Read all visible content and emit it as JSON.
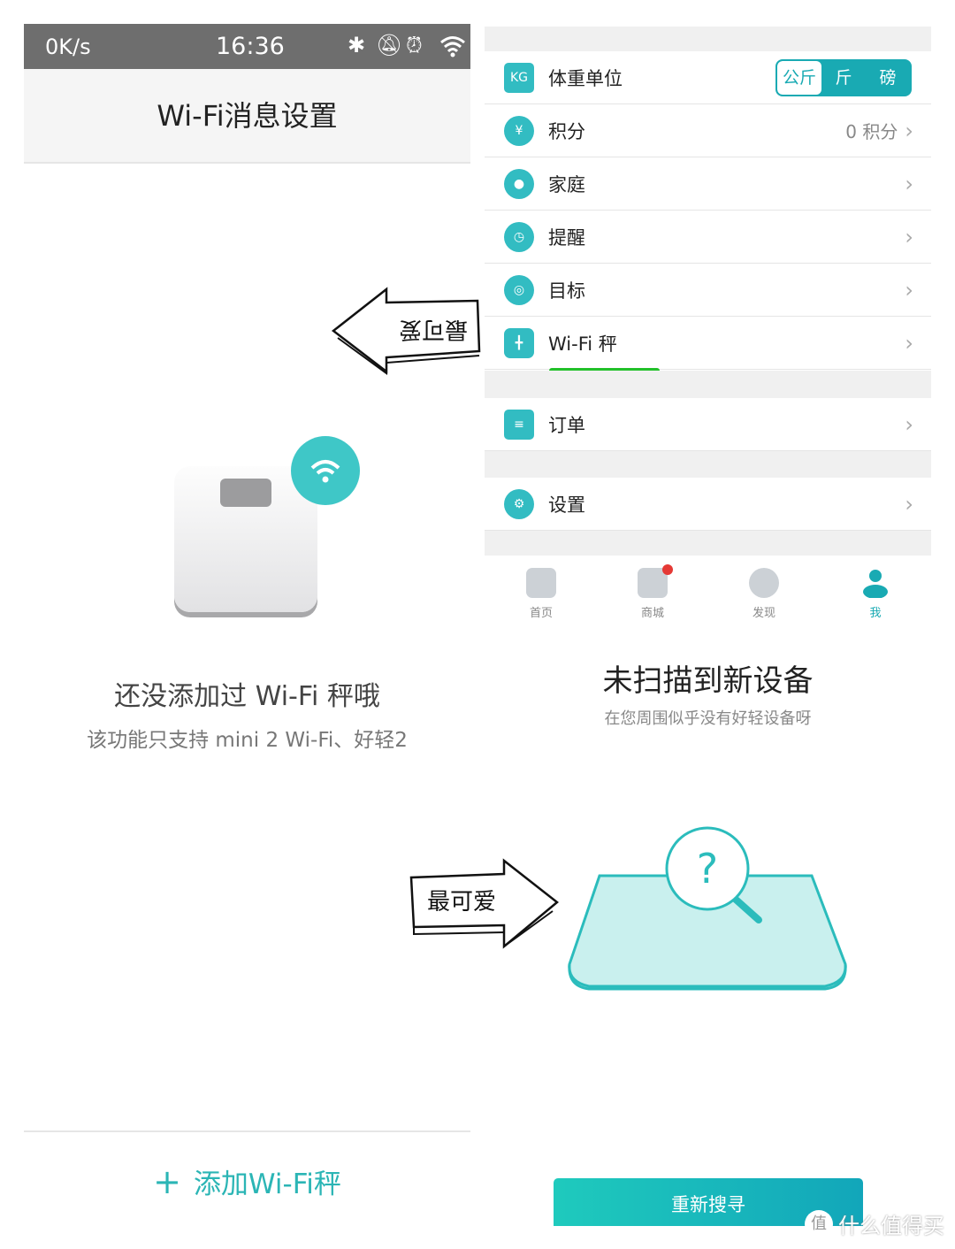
{
  "left": {
    "status": {
      "speed": "0K/s",
      "time": "16:36",
      "icons": [
        "bluetooth-icon",
        "bell-off-icon",
        "alarm-icon",
        "wifi-icon"
      ]
    },
    "title": "Wi-Fi消息设置",
    "empty_title": "还没添加过 Wi-Fi 秤哦",
    "empty_subtitle": "该功能只支持 mini 2 Wi-Fi、好轻2",
    "add_button": "添加Wi-Fi秤",
    "add_icon": "plus-icon"
  },
  "annotations": {
    "arrow_text": "最可爱",
    "underline_color": "#22c02a"
  },
  "right": {
    "unit_row": {
      "label": "体重单位",
      "options": [
        "公斤",
        "斤",
        "磅"
      ],
      "selected": "公斤",
      "icon_text": "KG"
    },
    "rows": [
      {
        "label": "积分",
        "value": "0 积分",
        "icon": "yuan-coin-icon"
      },
      {
        "label": "家庭",
        "value": "",
        "icon": "person-icon"
      },
      {
        "label": "提醒",
        "value": "",
        "icon": "clock-icon"
      },
      {
        "label": "目标",
        "value": "",
        "icon": "target-icon"
      },
      {
        "label": "Wi-Fi 秤",
        "value": "",
        "icon": "scale-icon"
      }
    ],
    "order": {
      "label": "订单",
      "icon": "clipboard-icon"
    },
    "settings": {
      "label": "设置",
      "icon": "gear-icon"
    },
    "tabs": [
      {
        "label": "首页"
      },
      {
        "label": "商城"
      },
      {
        "label": "发现"
      },
      {
        "label": "我"
      }
    ],
    "active_tab": "我",
    "empty_title": "未扫描到新设备",
    "empty_subtitle": "在您周围似乎没有好轻设备呀",
    "retry_button": "重新搜寻",
    "accent": "#19aab3"
  },
  "watermark": {
    "text": "什么值得买",
    "badge": "值"
  }
}
